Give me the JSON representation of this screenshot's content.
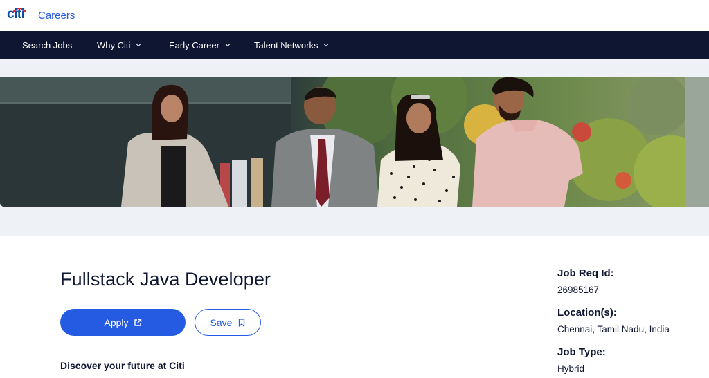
{
  "brand": {
    "logo_text": "citi",
    "careers_label": "Careers",
    "logo_color": "#0b4ea2",
    "arc_color": "#e4202e"
  },
  "nav": {
    "items": [
      {
        "label": "Search Jobs",
        "has_dropdown": false
      },
      {
        "label": "Why Citi",
        "has_dropdown": true
      },
      {
        "label": "Early Career",
        "has_dropdown": true
      },
      {
        "label": "Talent Networks",
        "has_dropdown": true
      }
    ]
  },
  "job": {
    "title": "Fullstack Java Developer",
    "apply_label": "Apply",
    "save_label": "Save",
    "intro_heading": "Discover your future at Citi"
  },
  "details": {
    "req_label": "Job Req Id:",
    "req_value": "26985167",
    "location_label": "Location(s):",
    "location_value": "Chennai, Tamil Nadu, India",
    "type_label": "Job Type:",
    "type_value": "Hybrid"
  },
  "colors": {
    "navy": "#0f1632",
    "accent_blue": "#255be3",
    "hero_band": "#eef2f6"
  },
  "icons": {
    "apply": "external-link-icon",
    "save": "bookmark-icon",
    "dropdown": "chevron-down-icon"
  }
}
